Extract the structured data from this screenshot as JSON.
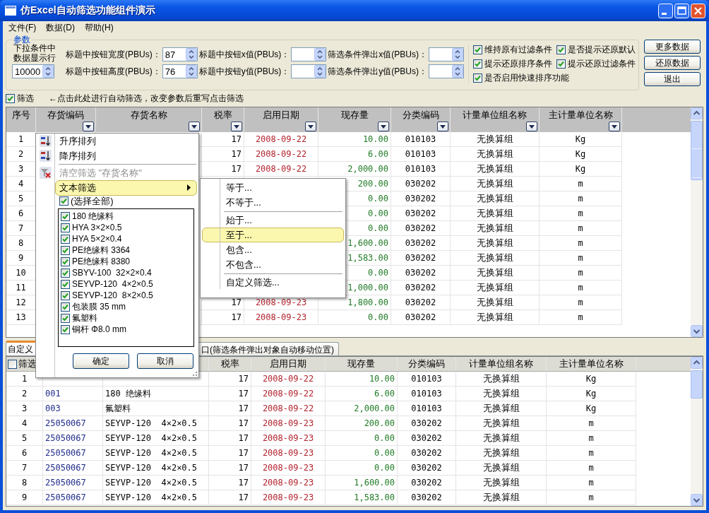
{
  "window": {
    "title": "仿Excel自动筛选功能组件演示"
  },
  "menu": [
    "文件(F)",
    "数据(D)",
    "帮助(H)"
  ],
  "parameters": {
    "title": "参数",
    "rows_label": "下拉条件中数据显示行",
    "rows_value": "10000",
    "fields": [
      {
        "label": "标题中按钮宽度(PBUs)：",
        "value": "87"
      },
      {
        "label": "标题中按钮x值(PBUs)："
      },
      {
        "label": "筛选条件弹出x值(PBUs)："
      },
      {
        "label": "标题中按钮高度(PBUs)：",
        "value": "76"
      },
      {
        "label": "标题中按钮y值(PBUs)："
      },
      {
        "label": "筛选条件弹出y值(PBUs)："
      }
    ],
    "options": [
      {
        "label": "维持原有过滤条件",
        "checked": true
      },
      {
        "label": "是否提示还原默认",
        "checked": true
      },
      {
        "label": "提示还原排序条件",
        "checked": true
      },
      {
        "label": "提示还原过滤条件",
        "checked": true
      },
      {
        "label": "是否启用快速排序功能",
        "checked": true
      }
    ]
  },
  "buttons": [
    "更多数据",
    "还原数据",
    "退出"
  ],
  "filter_toggle": {
    "label": "筛选",
    "checked": true,
    "hint": "←点击此处进行自动筛选，改变参数后重写点击筛选"
  },
  "top_grid": {
    "columns": [
      {
        "label": "序号",
        "filter_button": false
      },
      {
        "label": "存货编码",
        "filter_button": true
      },
      {
        "label": "存货名称",
        "filter_button": true
      },
      {
        "label": "税率",
        "filter_button": true
      },
      {
        "label": "启用日期",
        "filter_button": true
      },
      {
        "label": "现存量",
        "filter_button": true
      },
      {
        "label": "分类编码",
        "filter_button": true
      },
      {
        "label": "计量单位组名称",
        "filter_button": true
      },
      {
        "label": "主计量单位名称",
        "filter_button": true
      }
    ],
    "rows": [
      [
        "1",
        null,
        null,
        "17",
        "2008-09-22",
        "10.00",
        "010103",
        "无换算组",
        "Kg"
      ],
      [
        "2",
        null,
        null,
        "17",
        "2008-09-22",
        "6.00",
        "010103",
        "无换算组",
        "Kg"
      ],
      [
        "3",
        null,
        null,
        "17",
        "2008-09-22",
        "2,000.00",
        "010103",
        "无换算组",
        "Kg"
      ],
      [
        "4",
        null,
        null,
        null,
        null,
        "200.00",
        "030202",
        "无换算组",
        "m"
      ],
      [
        "5",
        null,
        null,
        null,
        null,
        "0.00",
        "030202",
        "无换算组",
        "m"
      ],
      [
        "6",
        null,
        null,
        null,
        null,
        "0.00",
        "030202",
        "无换算组",
        "m"
      ],
      [
        "7",
        null,
        null,
        null,
        null,
        "0.00",
        "030202",
        "无换算组",
        "m"
      ],
      [
        "8",
        null,
        null,
        null,
        null,
        "1,600.00",
        "030202",
        "无换算组",
        "m"
      ],
      [
        "9",
        null,
        null,
        null,
        null,
        "1,583.00",
        "030202",
        "无换算组",
        "m"
      ],
      [
        "10",
        null,
        null,
        null,
        null,
        "0.00",
        "030202",
        "无换算组",
        "m"
      ],
      [
        "11",
        null,
        null,
        null,
        null,
        "1,000.00",
        "030202",
        "无换算组",
        "m"
      ],
      [
        "12",
        null,
        null,
        "17",
        "2008-09-23",
        "1,800.00",
        "030202",
        "无换算组",
        "m"
      ],
      [
        "13",
        null,
        null,
        "17",
        "2008-09-23",
        "0.00",
        "030202",
        "无换算组",
        "m"
      ]
    ]
  },
  "bottom_tabs": [
    {
      "label": "自定义",
      "selected": true
    },
    {
      "label": "口(筛选条件弹出对象自动移动位置)",
      "selected": false
    }
  ],
  "bottom_grid": {
    "select_all": {
      "checked": false
    },
    "columns": [
      "筛选",
      null,
      null,
      "税率",
      "启用日期",
      "现存量",
      "分类编码",
      "计量单位组名称",
      "主计量单位名称"
    ],
    "rows": [
      [
        "1",
        null,
        null,
        "17",
        "2008-09-22",
        "10.00",
        "010103",
        "无换算组",
        "Kg"
      ],
      [
        "2",
        "001",
        "180 绝缘料",
        "17",
        "2008-09-22",
        "6.00",
        "010103",
        "无换算组",
        "Kg"
      ],
      [
        "3",
        "003",
        "氟塑料",
        "17",
        "2008-09-22",
        "2,000.00",
        "010103",
        "无换算组",
        "Kg"
      ],
      [
        "4",
        "25050067",
        "SEYVP-120  4×2×0.5",
        "17",
        "2008-09-23",
        "200.00",
        "030202",
        "无换算组",
        "m"
      ],
      [
        "5",
        "25050067",
        "SEYVP-120  4×2×0.5",
        "17",
        "2008-09-23",
        "0.00",
        "030202",
        "无换算组",
        "m"
      ],
      [
        "6",
        "25050067",
        "SEYVP-120  4×2×0.5",
        "17",
        "2008-09-23",
        "0.00",
        "030202",
        "无换算组",
        "m"
      ],
      [
        "7",
        "25050067",
        "SEYVP-120  4×2×0.5",
        "17",
        "2008-09-23",
        "0.00",
        "030202",
        "无换算组",
        "m"
      ],
      [
        "8",
        "25050067",
        "SEYVP-120  4×2×0.5",
        "17",
        "2008-09-23",
        "1,600.00",
        "030202",
        "无换算组",
        "m"
      ],
      [
        "9",
        "25050067",
        "SEYVP-120  4×2×0.5",
        "17",
        "2008-09-23",
        "1,583.00",
        "030202",
        "无换算组",
        "m"
      ]
    ]
  },
  "filter_popup": {
    "menu": [
      {
        "kind": "sort-ascending",
        "label": "升序排列",
        "disabled": false,
        "highlighted": false
      },
      {
        "kind": "sort-descending",
        "label": "降序排列",
        "disabled": false,
        "highlighted": false
      },
      {
        "kind": "separator"
      },
      {
        "kind": "clear-filter",
        "label": "清空筛选 \"存货名称\"",
        "disabled": true,
        "highlighted": false
      },
      {
        "kind": "submenu",
        "label": "文本筛选",
        "disabled": false,
        "highlighted": true
      }
    ],
    "select_all": {
      "label": "(选择全部)",
      "checked": true
    },
    "values": [
      {
        "label": "180 绝缘料",
        "checked": true
      },
      {
        "label": "HYA 3×2×0.5",
        "checked": true
      },
      {
        "label": "HYA 5×2×0.4",
        "checked": true
      },
      {
        "label": "PE绝缘料 3364",
        "checked": true
      },
      {
        "label": "PE绝缘料 8380",
        "checked": true
      },
      {
        "label": "SBYV-100  32×2×0.4",
        "checked": true
      },
      {
        "label": "SEYVP-120  4×2×0.5",
        "checked": true
      },
      {
        "label": "SEYVP-120  8×2×0.5",
        "checked": true
      },
      {
        "label": "包装膜 35 mm",
        "checked": true
      },
      {
        "label": "氟塑料",
        "checked": true
      },
      {
        "label": "铜杆 Φ8.0 mm",
        "checked": true
      }
    ],
    "buttons": [
      "确定",
      "取消"
    ]
  },
  "text_filter_menu": [
    {
      "kind": "item",
      "label": "等于...",
      "highlighted": false
    },
    {
      "kind": "item",
      "label": "不等于...",
      "highlighted": false
    },
    {
      "kind": "separator"
    },
    {
      "kind": "item",
      "label": "始于...",
      "highlighted": false
    },
    {
      "kind": "item",
      "label": "至于...",
      "highlighted": true
    },
    {
      "kind": "item",
      "label": "包含...",
      "highlighted": false
    },
    {
      "kind": "item",
      "label": "不包含...",
      "highlighted": false
    },
    {
      "kind": "separator"
    },
    {
      "kind": "item",
      "label": "自定义筛选...",
      "highlighted": false
    }
  ]
}
